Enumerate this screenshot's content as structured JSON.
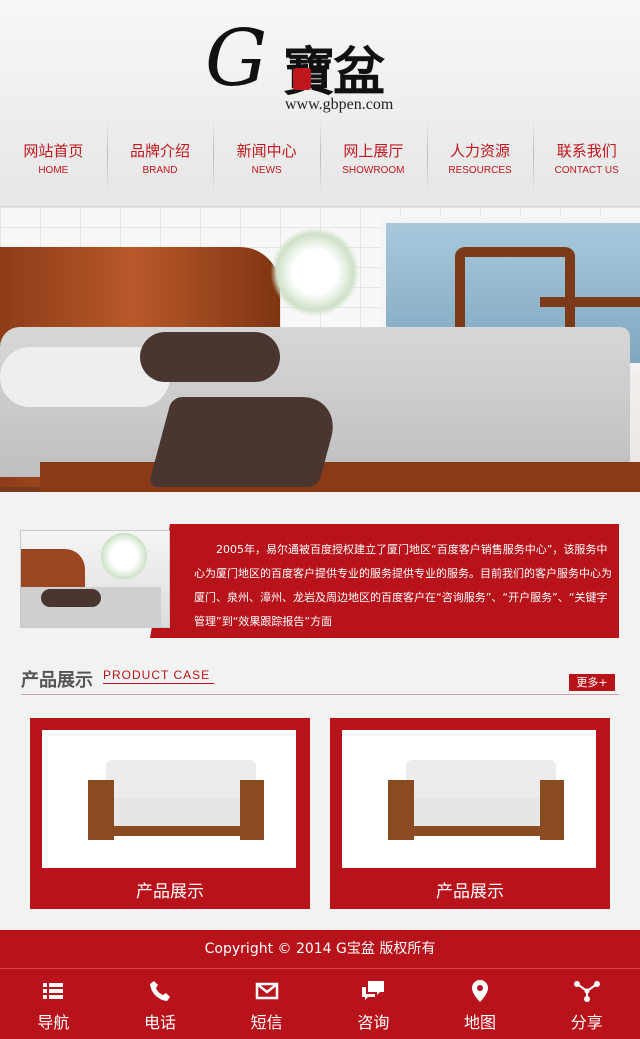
{
  "logo": {
    "brand_letter": "G",
    "brand_cn": "寶盆",
    "url": "www.gbpen.com"
  },
  "nav": [
    {
      "cn": "网站首页",
      "en": "HOME"
    },
    {
      "cn": "品牌介绍",
      "en": "BRAND"
    },
    {
      "cn": "新闻中心",
      "en": "NEWS"
    },
    {
      "cn": "网上展厅",
      "en": "SHOWROOM"
    },
    {
      "cn": "人力资源",
      "en": "RESOURCES"
    },
    {
      "cn": "联系我们",
      "en": "CONTACT US"
    }
  ],
  "intro": {
    "text": "　　2005年，易尔通被百度授权建立了厦门地区“百度客户销售服务中心”，该服务中心为厦门地区的百度客户提供专业的服务提供专业的服务。目前我们的客户服务中心为厦门、泉州、漳州、龙岩及周边地区的百度客户在“咨询服务”、“开户服务”、“关键字管理”到“效果跟踪报告”方面"
  },
  "products_section": {
    "title": "产品展示",
    "title_en": "PRODUCT CASE",
    "more_label": "更多+",
    "items": [
      {
        "caption": "产品展示"
      },
      {
        "caption": "产品展示"
      }
    ]
  },
  "footer": {
    "copyright": "Copyright © 2014 G宝盆 版权所有"
  },
  "bottom_nav": [
    {
      "label": "导航",
      "icon": "menu-icon"
    },
    {
      "label": "电话",
      "icon": "phone-icon"
    },
    {
      "label": "短信",
      "icon": "envelope-icon"
    },
    {
      "label": "咨询",
      "icon": "chat-icon"
    },
    {
      "label": "地图",
      "icon": "map-pin-icon"
    },
    {
      "label": "分享",
      "icon": "share-icon"
    }
  ],
  "colors": {
    "brand_red": "#b8121a",
    "nav_text": "#c0161d"
  }
}
